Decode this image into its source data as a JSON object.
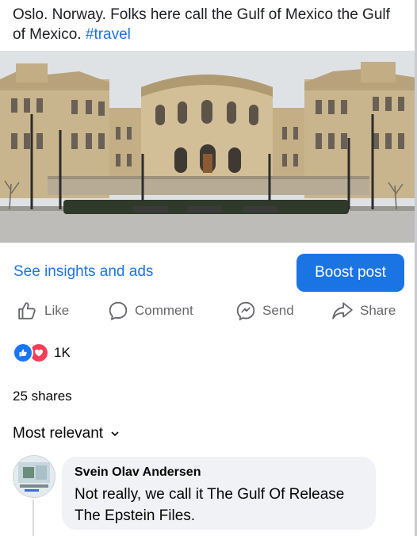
{
  "post": {
    "caption_text": "Oslo. Norway. Folks here call the Gulf of Mexico the Gulf of Mexico.",
    "hashtag": "#travel",
    "image_alt": "Storting building, Oslo"
  },
  "insights_link": "See insights and ads",
  "boost_label": "Boost post",
  "actions": {
    "like": "Like",
    "comment": "Comment",
    "send": "Send",
    "share": "Share"
  },
  "reactions": {
    "count": "1K",
    "icons": [
      "like-icon",
      "love-icon"
    ]
  },
  "shares_text": "25 shares",
  "sort_label": "Most relevant",
  "comment": {
    "author": "Svein Olav Andersen",
    "text": "Not really, we call it The Gulf Of Release The Epstein Files."
  },
  "colors": {
    "accent": "#1b74e4",
    "secondary_text": "#65676b",
    "bubble_bg": "#f0f2f5",
    "love": "#f33e58"
  }
}
